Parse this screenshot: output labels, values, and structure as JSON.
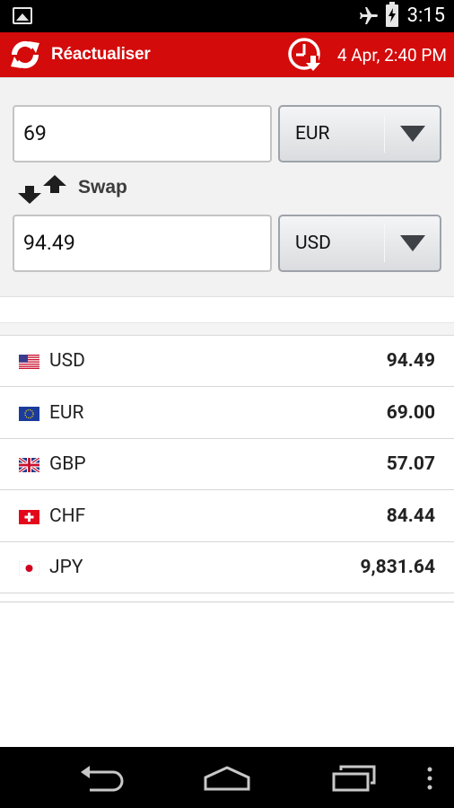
{
  "status_bar": {
    "time": "3:15",
    "icons": [
      "gallery-icon",
      "airplane-mode-icon",
      "battery-charging-icon"
    ]
  },
  "action_bar": {
    "refresh_label": "Réactualiser",
    "timestamp": "4 Apr, 2:40 PM",
    "icons": [
      "refresh-icon",
      "clock-download-icon"
    ]
  },
  "converter": {
    "from_amount": "69",
    "from_currency": "EUR",
    "swap_label": "Swap",
    "to_amount": "94.49",
    "to_currency": "USD"
  },
  "rates": [
    {
      "code": "USD",
      "amount": "94.49",
      "flag": "us-flag"
    },
    {
      "code": "EUR",
      "amount": "69.00",
      "flag": "eu-flag"
    },
    {
      "code": "GBP",
      "amount": "57.07",
      "flag": "uk-flag"
    },
    {
      "code": "CHF",
      "amount": "84.44",
      "flag": "ch-flag"
    },
    {
      "code": "JPY",
      "amount": "9,831.64",
      "flag": "jp-flag"
    }
  ],
  "nav_bar": {
    "icons": [
      "back-icon",
      "home-icon",
      "recents-icon",
      "overflow-menu-icon"
    ]
  },
  "colors": {
    "accent": "#d40b0b",
    "panel_bg": "#f2f2f2",
    "text": "#222222"
  }
}
